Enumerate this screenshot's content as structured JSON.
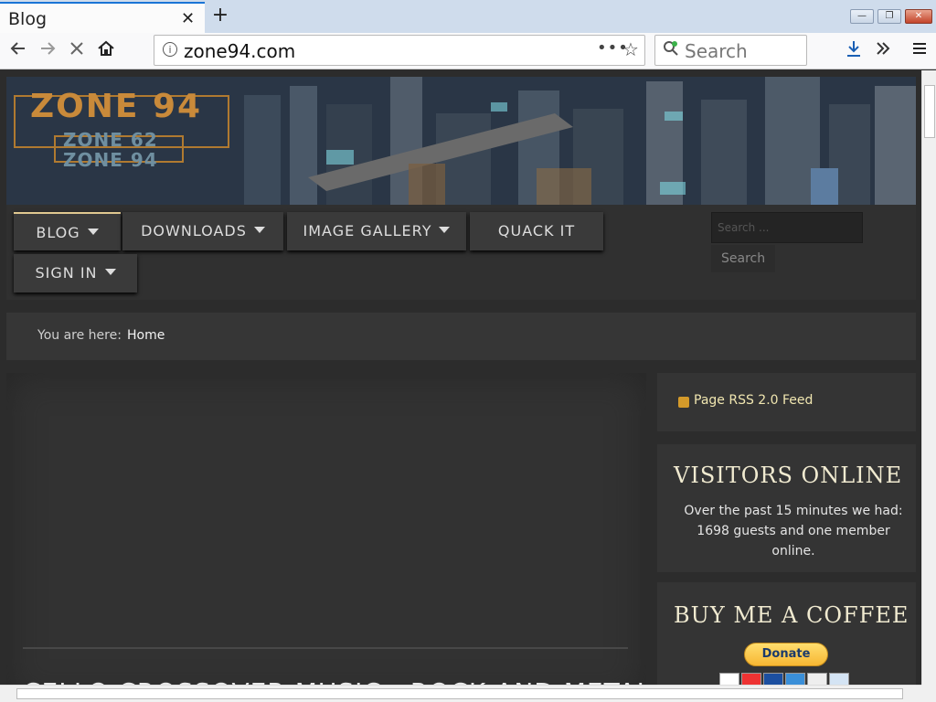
{
  "browser": {
    "tab_title": "Blog",
    "tab_close": "✕",
    "new_tab": "+",
    "url": "zone94.com",
    "url_more": "•••",
    "search_placeholder": "Search",
    "window_buttons": {
      "minimize": "—",
      "restore": "❐",
      "close": "✕"
    }
  },
  "site": {
    "logo": {
      "main": "ZONE 94",
      "sub1": "ZONE 62",
      "sub2": "ZONE 94"
    },
    "menu": [
      {
        "label": "BLOG",
        "has_caret": true,
        "active": true
      },
      {
        "label": "DOWNLOADS",
        "has_caret": true,
        "active": false
      },
      {
        "label": "IMAGE GALLERY",
        "has_caret": true,
        "active": false
      },
      {
        "label": "QUACK IT",
        "has_caret": false,
        "active": false
      },
      {
        "label": "SIGN IN",
        "has_caret": true,
        "active": false
      }
    ],
    "search": {
      "placeholder": "Search ...",
      "button": "Search"
    },
    "breadcrumb": {
      "label": "You are here:",
      "home": "Home"
    },
    "article_title": "CELLO CROSSOVER MUSIC - ROCK AND METAL",
    "sidebar": {
      "rss": "Page RSS 2.0 Feed",
      "visitors_heading": "VISITORS ONLINE",
      "visitors_text": "Over the past 15 minutes we had: 1698 guests and one member online.",
      "coffee_heading": "BUY ME A COFFEE",
      "donate": "Donate"
    }
  },
  "colors": {
    "accent_active_tab": "#1a74d6",
    "logo_orange": "#c98a3a",
    "rss_text": "#f0e6b0",
    "donate_yellow": "#f7b733"
  }
}
